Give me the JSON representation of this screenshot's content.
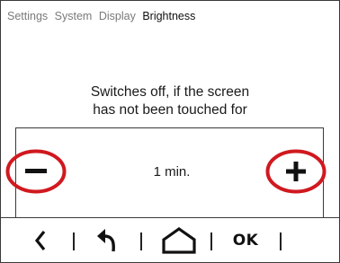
{
  "breadcrumb": {
    "items": [
      "Settings",
      "System",
      "Display"
    ],
    "current": "Brightness"
  },
  "message": {
    "line1": "Switches off, if the screen",
    "line2": "has not been touched for"
  },
  "timeout": {
    "value": "1 min."
  },
  "controls": {
    "decrease_icon": "minus-icon",
    "increase_icon": "plus-icon",
    "highlight_color": "#d0191f"
  },
  "navbar": {
    "back_icon": "chevron-left-icon",
    "undo_icon": "undo-arrow-icon",
    "home_icon": "home-icon",
    "ok_label": "OK"
  }
}
